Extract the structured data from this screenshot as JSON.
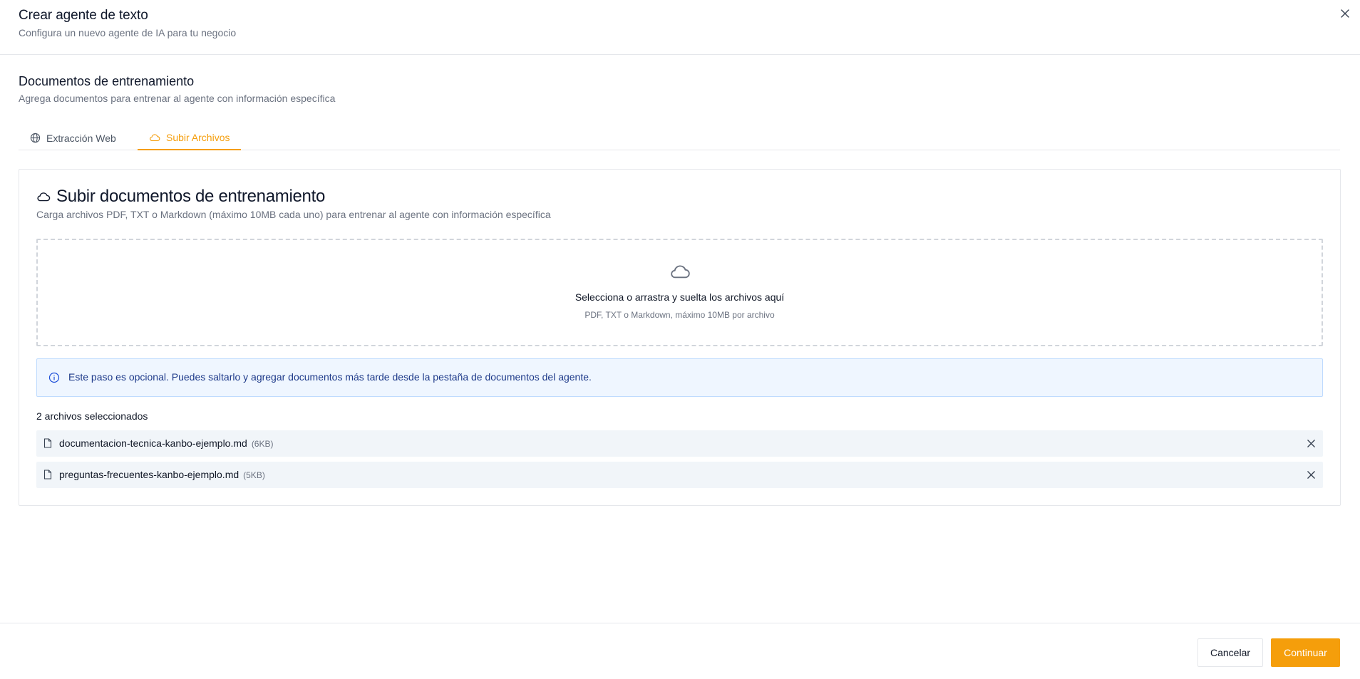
{
  "header": {
    "title": "Crear agente de texto",
    "subtitle": "Configura un nuevo agente de IA para tu negocio",
    "close_icon": "close-icon"
  },
  "section": {
    "title": "Documentos de entrenamiento",
    "subtitle": "Agrega documentos para entrenar al agente con información específica"
  },
  "tabs": [
    {
      "label": "Extracción Web",
      "icon": "globe-icon",
      "active": false
    },
    {
      "label": "Subir Archivos",
      "icon": "cloud-icon",
      "active": true
    }
  ],
  "upload_card": {
    "title": "Subir documentos de entrenamiento",
    "subtitle": "Carga archivos PDF, TXT o Markdown (máximo 10MB cada uno) para entrenar al agente con información específica",
    "dropzone": {
      "title": "Selecciona o arrastra y suelta los archivos aquí",
      "hint": "PDF, TXT o Markdown, máximo 10MB por archivo"
    },
    "info": {
      "text": "Este paso es opcional. Puedes saltarlo y agregar documentos más tarde desde la pestaña de documentos del agente."
    },
    "files_count": "2 archivos seleccionados",
    "files": [
      {
        "name": "documentacion-tecnica-kanbo-ejemplo.md",
        "size": "(6KB)"
      },
      {
        "name": "preguntas-frecuentes-kanbo-ejemplo.md",
        "size": "(5KB)"
      }
    ]
  },
  "footer": {
    "cancel_label": "Cancelar",
    "continue_label": "Continuar"
  },
  "colors": {
    "accent": "#f59e0b",
    "info_bg": "#eff6ff",
    "info_border": "#bfdbfe",
    "info_text": "#1e3a8a",
    "muted_text": "#6b7280"
  }
}
